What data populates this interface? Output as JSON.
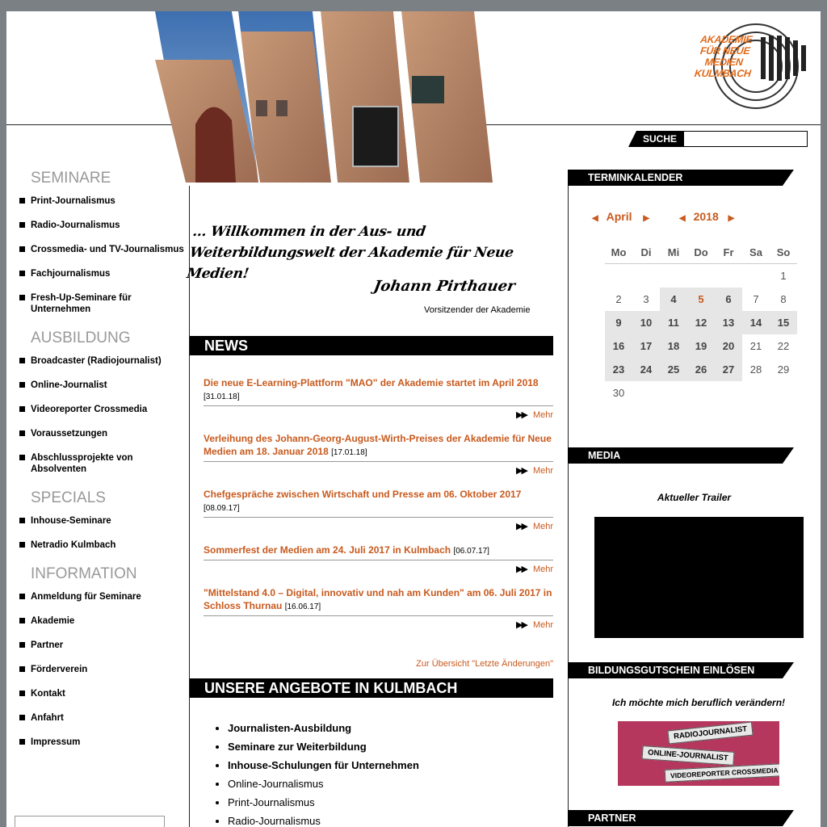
{
  "search": {
    "label": "SUCHE",
    "value": ""
  },
  "logo": {
    "text": "AKADEMIE FÜR NEUE MEDIEN KULMBACH"
  },
  "nav": {
    "sections": [
      {
        "heading": "SEMINARE",
        "items": [
          "Print-Journalismus",
          "Radio-Journalismus",
          "Crossmedia- und TV-Journalismus",
          "Fachjournalismus",
          "Fresh-Up-Seminare für Unternehmen"
        ]
      },
      {
        "heading": "AUSBILDUNG",
        "items": [
          "Broadcaster (Radiojournalist)",
          "Online-Journalist",
          "Videoreporter Crossmedia",
          "Voraussetzungen",
          "Abschlussprojekte von Absolventen"
        ]
      },
      {
        "heading": "SPECIALS",
        "items": [
          "Inhouse-Seminare",
          "Netradio Kulmbach"
        ]
      },
      {
        "heading": "INFORMATION",
        "items": [
          "Anmeldung für Seminare",
          "Akademie",
          "Partner",
          "Förderverein",
          "Kontakt",
          "Anfahrt",
          "Impressum"
        ]
      }
    ]
  },
  "welcome": {
    "line1": "... Willkommen in der Aus- und",
    "line2": "Weiterbildungswelt der Akademie für Neue Medien!",
    "signature": "Johann Pirthauer",
    "role": "Vorsitzender der Akademie"
  },
  "news": {
    "heading": "NEWS",
    "more_label": "Mehr",
    "overview_link": "Zur Übersicht \"Letzte Änderungen\"",
    "items": [
      {
        "title": "Die neue E-Learning-Plattform \"MAO\" der Akademie startet im April 2018",
        "date": "[31.01.18]"
      },
      {
        "title": "Verleihung des Johann-Georg-August-Wirth-Preises der Akademie für Neue Medien am 18. Januar 2018",
        "date": "[17.01.18]"
      },
      {
        "title": "Chefgespräche zwischen Wirtschaft und Presse am 06. Oktober 2017",
        "date": "[08.09.17]"
      },
      {
        "title": "Sommerfest der Medien am 24. Juli 2017 in Kulmbach",
        "date": "[06.07.17]"
      },
      {
        "title": "\"Mittelstand 4.0 – Digital, innovativ und nah am Kunden\" am 06. Juli 2017 in Schloss Thurnau",
        "date": "[16.06.17]"
      }
    ]
  },
  "offers": {
    "heading": "UNSERE ANGEBOTE IN KULMBACH",
    "items": [
      {
        "label": "Journalisten-Ausbildung",
        "strong": true
      },
      {
        "label": "Seminare zur Weiterbildung",
        "strong": true
      },
      {
        "label": "Inhouse-Schulungen für Unternehmen",
        "strong": true
      },
      {
        "label": "Online-Journalismus",
        "strong": false
      },
      {
        "label": "Print-Journalismus",
        "strong": false
      },
      {
        "label": "Radio-Journalismus",
        "strong": false
      }
    ]
  },
  "calendar": {
    "heading": "TERMINKALENDER",
    "month": "April",
    "year": "2018",
    "weekdays": [
      "Mo",
      "Di",
      "Mi",
      "Do",
      "Fr",
      "Sa",
      "So"
    ],
    "weeks": [
      [
        "",
        "",
        "",
        "",
        "",
        "",
        "1"
      ],
      [
        "2",
        "3",
        "4",
        "5",
        "6",
        "7",
        "8"
      ],
      [
        "9",
        "10",
        "11",
        "12",
        "13",
        "14",
        "15"
      ],
      [
        "16",
        "17",
        "18",
        "19",
        "20",
        "21",
        "22"
      ],
      [
        "23",
        "24",
        "25",
        "26",
        "27",
        "28",
        "29"
      ],
      [
        "30",
        "",
        "",
        "",
        "",
        "",
        ""
      ]
    ],
    "highlighted_days": [
      "4",
      "5",
      "6",
      "9",
      "10",
      "11",
      "12",
      "13",
      "14",
      "15",
      "16",
      "17",
      "18",
      "19",
      "20",
      "23",
      "24",
      "25",
      "26",
      "27"
    ],
    "accent_days": [
      "5"
    ]
  },
  "media": {
    "heading": "MEDIA",
    "trailer_label": "Aktueller Trailer"
  },
  "voucher": {
    "heading": "BILDUNGSGUTSCHEIN EINLÖSEN",
    "label": "Ich möchte mich beruflich verändern!",
    "tags": [
      "RADIOJOURNALIST",
      "ONLINE-JOURNALIST",
      "VIDEOREPORTER CROSSMEDIA"
    ]
  },
  "partner": {
    "heading": "PARTNER"
  },
  "colors": {
    "accent": "#c85a1e",
    "logo_orange": "#e06a1a",
    "bar": "#000000",
    "nav_heading": "#999999"
  }
}
